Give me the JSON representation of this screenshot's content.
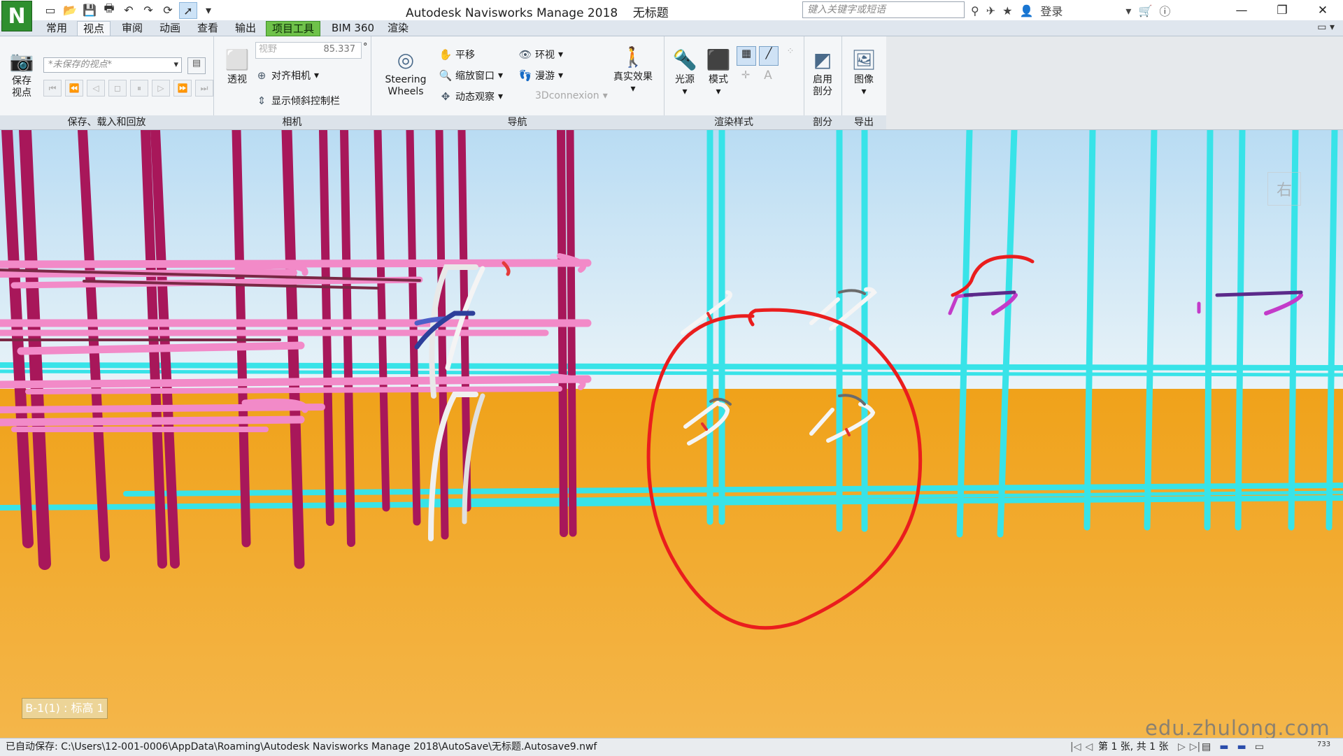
{
  "titlebar": {
    "logo": "N",
    "title": "Autodesk Navisworks Manage 2018    无标题",
    "search_placeholder": "键入关键字或短语",
    "login": "登录"
  },
  "tabs": [
    "常用",
    "视点",
    "审阅",
    "动画",
    "查看",
    "输出",
    "项目工具",
    "BIM 360",
    "渲染"
  ],
  "active_tab": "视点",
  "contextual_tab": "项目工具",
  "ribbon": {
    "save_panel": {
      "title": "保存、载入和回放",
      "save_viewpoint": "保存\n视点",
      "viewpoint_combo": "*未保存的视点*"
    },
    "camera_panel": {
      "title": "相机",
      "perspective": "透视",
      "fov_label": "视野",
      "fov_value": "85.337",
      "align_camera": "对齐相机",
      "show_tilt": "显示倾斜控制栏"
    },
    "nav_panel": {
      "title": "导航",
      "steering_wheels": "Steering\nWheels",
      "pan": "平移",
      "zoom_window": "缩放窗口",
      "orbit": "动态观察",
      "look_around": "环视",
      "walk": "漫游",
      "connexion": "3Dconnexion",
      "realism": "真实效果"
    },
    "render_panel": {
      "title": "渲染样式",
      "lighting": "光源",
      "mode": "模式"
    },
    "section_panel": {
      "title": "剖分",
      "enable_sectioning": "启用\n剖分"
    },
    "export_panel": {
      "title": "导出",
      "image": "图像"
    }
  },
  "viewport": {
    "level_label": "B-1(1) : 标高 1",
    "viewcube_face": "右",
    "watermark": "edu.zhulong.com"
  },
  "statusbar": {
    "autosave": "已自动保存: C:\\Users\\12-001-0006\\AppData\\Roaming\\Autodesk Navisworks Manage 2018\\AutoSave\\无标题.Autosave9.nwf",
    "sheet_info": "第 1 张, 共 1 张",
    "memory": "733"
  }
}
